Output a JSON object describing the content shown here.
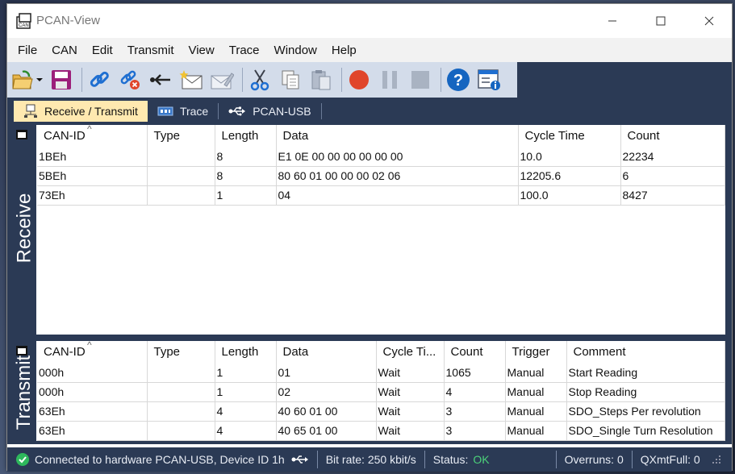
{
  "window": {
    "title": "PCAN-View"
  },
  "menu": [
    "File",
    "CAN",
    "Edit",
    "Transmit",
    "View",
    "Trace",
    "Window",
    "Help"
  ],
  "toolbar": {
    "icons": [
      "open-icon",
      "dropdown-arrow-icon",
      "save-icon",
      "connect-icon",
      "disconnect-icon",
      "reset-icon",
      "new-message-icon",
      "edit-message-icon",
      "cut-icon",
      "copy-icon",
      "paste-icon",
      "record-icon",
      "pause-icon",
      "stop-icon",
      "help-icon",
      "properties-icon"
    ],
    "colors": {
      "record": "#e0452a",
      "inactive": "#a9b3c2",
      "help": "#1565c0"
    }
  },
  "tabs": [
    {
      "label": "Receive / Transmit",
      "icon": "network-icon",
      "active": true
    },
    {
      "label": "Trace",
      "icon": "trace-icon",
      "active": false
    },
    {
      "label": "PCAN-USB",
      "icon": "usb-icon",
      "active": false
    }
  ],
  "receive": {
    "side_label": "Receive",
    "columns": [
      "CAN-ID",
      "Type",
      "Length",
      "Data",
      "Cycle Time",
      "Count"
    ],
    "rows": [
      [
        "1BEh",
        "",
        "8",
        "E1 0E 00 00 00 00 00 00",
        "10.0",
        "22234"
      ],
      [
        "5BEh",
        "",
        "8",
        "80 60 01 00 00 00 02 06",
        "12205.6",
        "6"
      ],
      [
        "73Eh",
        "",
        "1",
        "04",
        "100.0",
        "8427"
      ]
    ]
  },
  "transmit": {
    "side_label": "Transmit",
    "columns": [
      "CAN-ID",
      "Type",
      "Length",
      "Data",
      "Cycle Ti...",
      "Count",
      "Trigger",
      "Comment"
    ],
    "rows": [
      [
        "000h",
        "",
        "1",
        "01",
        "Wait",
        "1065",
        "Manual",
        "Start Reading"
      ],
      [
        "000h",
        "",
        "1",
        "02",
        "Wait",
        "4",
        "Manual",
        "Stop Reading"
      ],
      [
        "63Eh",
        "",
        "4",
        "40 60 01 00",
        "Wait",
        "3",
        "Manual",
        "SDO_Steps Per revolution"
      ],
      [
        "63Eh",
        "",
        "4",
        "40 65 01 00",
        "Wait",
        "3",
        "Manual",
        "SDO_Single Turn Resolution"
      ]
    ]
  },
  "status": {
    "connection": "Connected to hardware PCAN-USB, Device ID 1h",
    "bitrate": "Bit rate: 250 kbit/s",
    "status_label": "Status:",
    "status_value": "OK",
    "overruns": "Overruns: 0",
    "qxmtfull": "QXmtFull: 0",
    "ok_color": "#4cd17a"
  }
}
